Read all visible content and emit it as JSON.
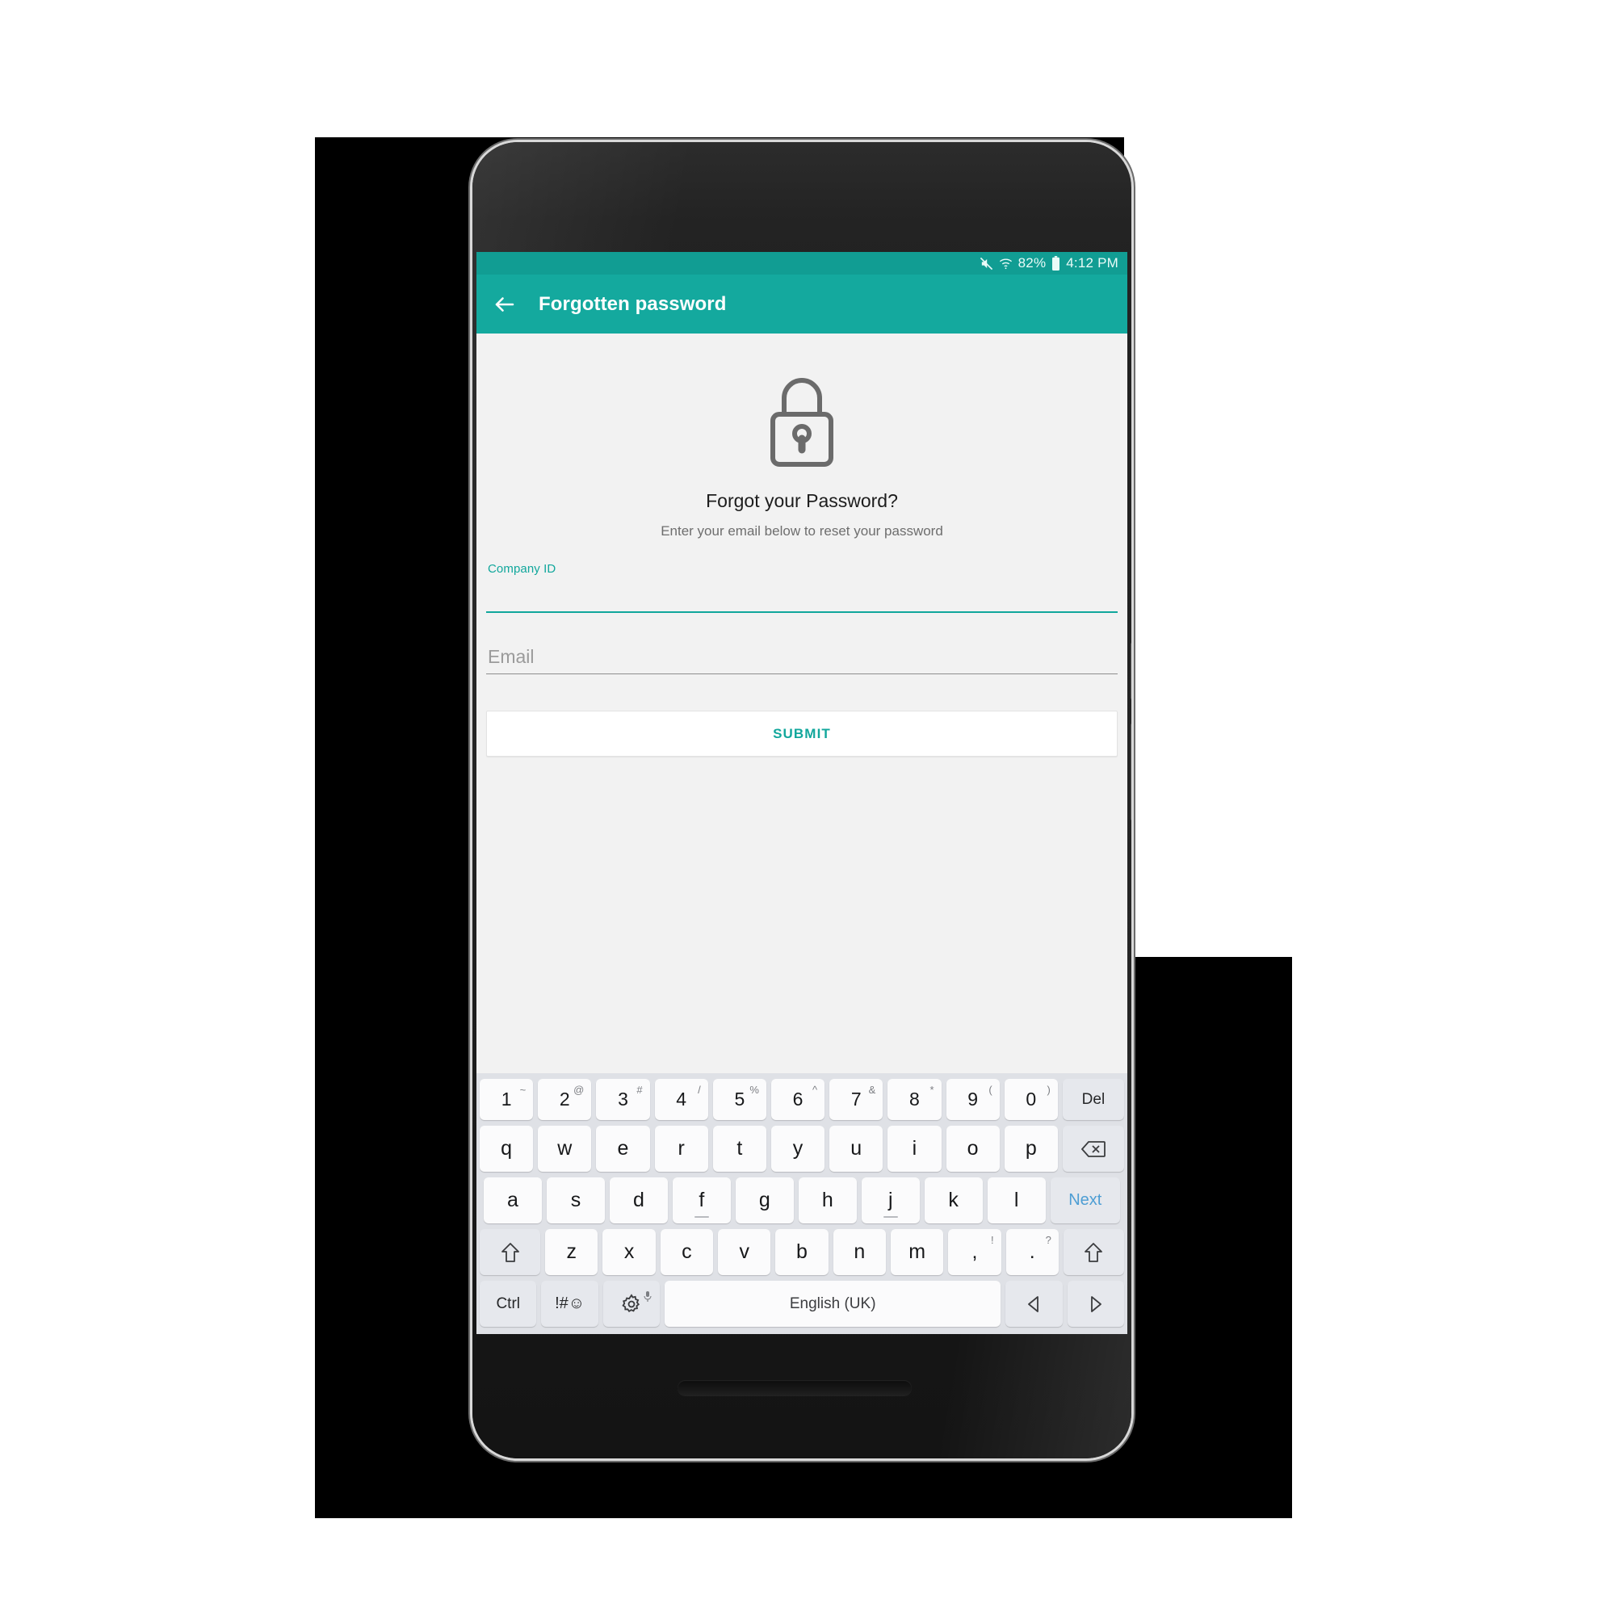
{
  "device": {
    "name": "android-phone-mockup"
  },
  "status_bar": {
    "mute_icon": "mute-icon",
    "wifi_icon": "wifi-icon",
    "battery_percent": "82%",
    "battery_icon": "battery-icon",
    "clock": "4:12 PM",
    "background_color": "#119d93"
  },
  "app_bar": {
    "back_icon": "back-arrow-icon",
    "title": "Forgotten password",
    "background_color": "#14a99e",
    "text_color": "#ffffff"
  },
  "content": {
    "lock_icon": "lock-icon",
    "headline": "Forgot your Password?",
    "subline": "Enter your email below to reset your password",
    "accent_color": "#11a79c",
    "background_color": "#f2f2f2"
  },
  "form": {
    "company": {
      "label": "Company ID",
      "value": "",
      "placeholder": "",
      "focused": true
    },
    "email": {
      "label": "Email",
      "value": "",
      "placeholder": "Email",
      "focused": false
    },
    "submit_label": "SUBMIT",
    "submit_text_color": "#12a79c"
  },
  "keyboard": {
    "language": "English (UK)",
    "background_color": "#dfe1e6",
    "key_color": "#fbfbfc",
    "func_key_color": "#e6e8ed",
    "rows": {
      "numbers": [
        {
          "main": "1",
          "sup": "~"
        },
        {
          "main": "2",
          "sup": "@"
        },
        {
          "main": "3",
          "sup": "#"
        },
        {
          "main": "4",
          "sup": "/"
        },
        {
          "main": "5",
          "sup": "%"
        },
        {
          "main": "6",
          "sup": "^"
        },
        {
          "main": "7",
          "sup": "&"
        },
        {
          "main": "8",
          "sup": "*"
        },
        {
          "main": "9",
          "sup": "("
        },
        {
          "main": "0",
          "sup": ")"
        }
      ],
      "del_label": "Del",
      "top": [
        "q",
        "w",
        "e",
        "r",
        "t",
        "y",
        "u",
        "i",
        "o",
        "p"
      ],
      "backspace_icon": "backspace-icon",
      "home": [
        "a",
        "s",
        "d",
        "f",
        "g",
        "h",
        "j",
        "k",
        "l"
      ],
      "next_label": "Next",
      "bottom": [
        "z",
        "x",
        "c",
        "v",
        "b",
        "n",
        "m"
      ],
      "comma": {
        "main": ",",
        "sup": "!"
      },
      "period": {
        "main": ".",
        "sup": "?"
      },
      "shift_left_icon": "shift-icon",
      "shift_right_icon": "shift-icon",
      "ctrl_label": "Ctrl",
      "symbols_label": "!#☺",
      "settings_icon": "gear-icon",
      "mic_icon": "microphone-icon",
      "arrow_left_icon": "arrow-left-icon",
      "arrow_right_icon": "arrow-right-icon"
    }
  }
}
